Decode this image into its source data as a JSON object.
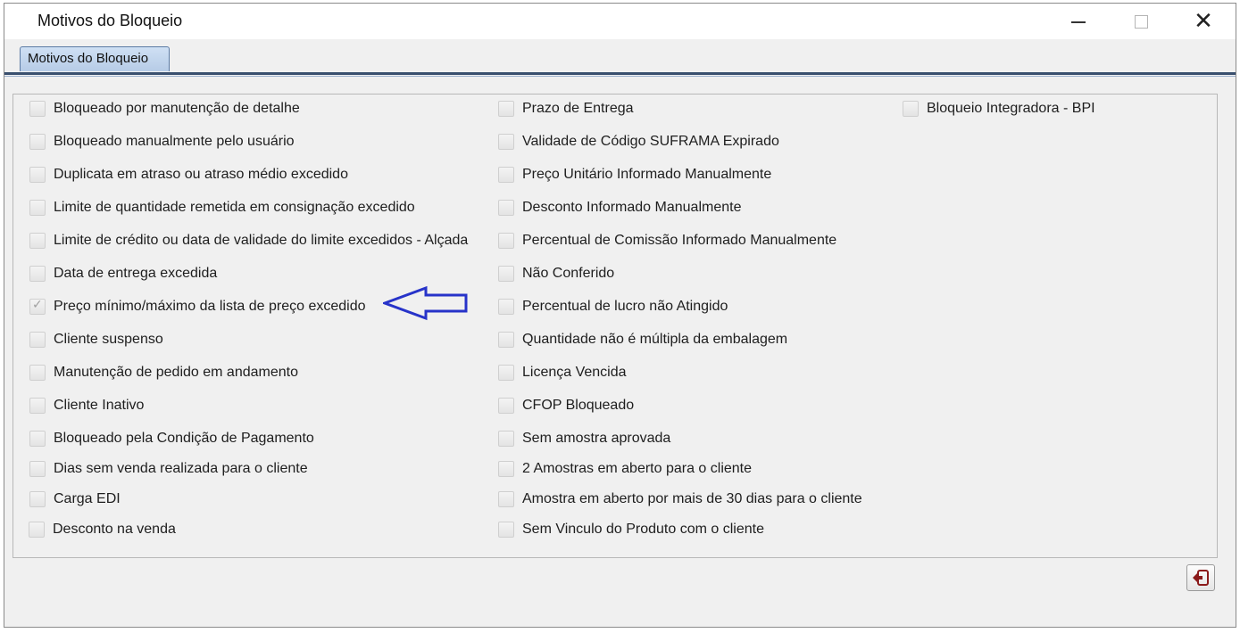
{
  "window": {
    "title": "Motivos do Bloqueio"
  },
  "tab": {
    "label": "Motivos do Bloqueio"
  },
  "checkboxes": [
    {
      "label": "Bloqueado por manutenção de detalhe",
      "checked": false
    },
    {
      "label": "Bloqueado manualmente pelo usuário",
      "checked": false
    },
    {
      "label": "Duplicata em atraso ou atraso médio excedido",
      "checked": false
    },
    {
      "label": "Limite de quantidade remetida em consignação excedido",
      "checked": false
    },
    {
      "label": "Limite de crédito ou data de validade do limite excedidos - Alçada",
      "checked": false
    },
    {
      "label": "Data de entrega excedida",
      "checked": false
    },
    {
      "label": "Preço mínimo/máximo da lista de preço excedido",
      "checked": true
    },
    {
      "label": "Cliente suspenso",
      "checked": false
    },
    {
      "label": "Manutenção de pedido em andamento",
      "checked": false
    },
    {
      "label": "Cliente Inativo",
      "checked": false
    },
    {
      "label": "Bloqueado pela Condição de Pagamento",
      "checked": false
    },
    {
      "label": "Dias sem venda realizada para o cliente",
      "checked": false
    },
    {
      "label": "Carga EDI",
      "checked": false
    },
    {
      "label": "Desconto na venda",
      "checked": false
    },
    {
      "label": "Prazo de Entrega",
      "checked": false
    },
    {
      "label": "Validade de Código SUFRAMA Expirado",
      "checked": false
    },
    {
      "label": "Preço Unitário Informado Manualmente",
      "checked": false
    },
    {
      "label": "Desconto Informado Manualmente",
      "checked": false
    },
    {
      "label": "Percentual de Comissão Informado Manualmente",
      "checked": false
    },
    {
      "label": "Não Conferido",
      "checked": false
    },
    {
      "label": "Percentual de lucro não Atingido",
      "checked": false
    },
    {
      "label": "Quantidade não é múltipla da embalagem",
      "checked": false
    },
    {
      "label": "Licença Vencida",
      "checked": false
    },
    {
      "label": "CFOP Bloqueado",
      "checked": false
    },
    {
      "label": "Sem amostra aprovada",
      "checked": false
    },
    {
      "label": "2 Amostras em aberto para o cliente",
      "checked": false
    },
    {
      "label": "Amostra em aberto por mais de 30 dias para o cliente",
      "checked": false
    },
    {
      "label": "Sem Vinculo do Produto com o cliente",
      "checked": false
    },
    {
      "label": "Bloqueio Integradora - BPI",
      "checked": false
    }
  ],
  "colors": {
    "tab_active": "#b6cbe6",
    "annotation_arrow": "#2733c9",
    "exit_icon": "#8b1a1a"
  },
  "icons": {
    "exit": "exit-door-icon",
    "close": "close-icon",
    "minimize": "minimize-icon",
    "maximize": "maximize-icon"
  }
}
